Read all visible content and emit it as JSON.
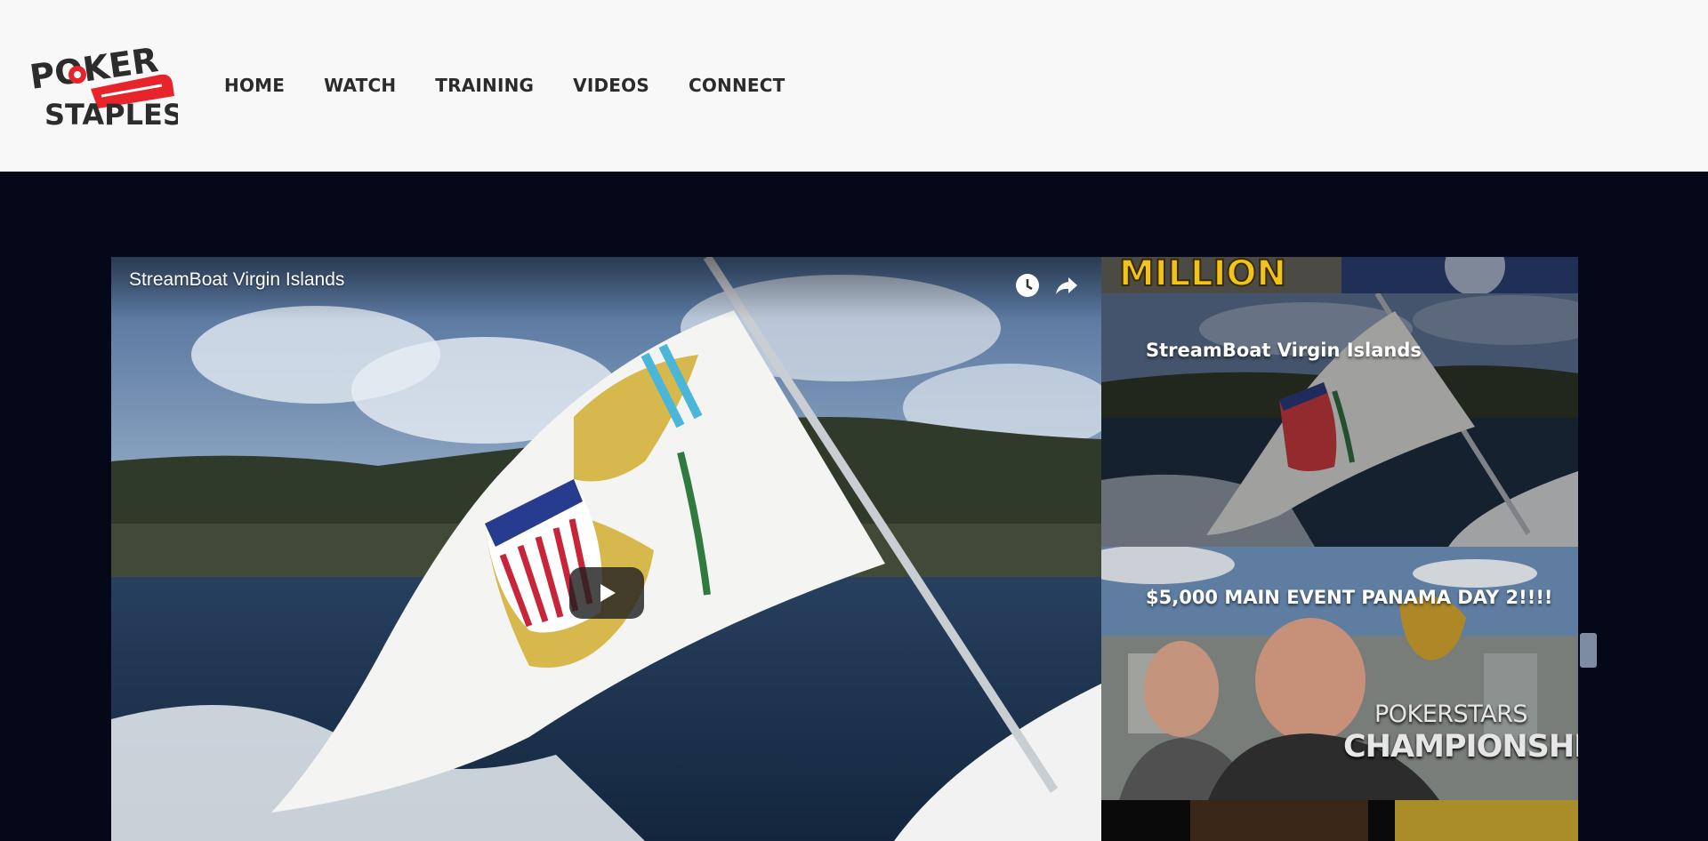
{
  "brand": {
    "logo_text_top": "POKER",
    "logo_text_bottom": "STAPLES",
    "accent": "#e8242b"
  },
  "nav": {
    "items": [
      {
        "label": "HOME"
      },
      {
        "label": "WATCH"
      },
      {
        "label": "TRAINING"
      },
      {
        "label": "VIDEOS"
      },
      {
        "label": "CONNECT"
      }
    ]
  },
  "player": {
    "title": "StreamBoat Virgin Islands",
    "icons": [
      "watch-later-icon",
      "share-icon",
      "play-icon"
    ]
  },
  "playlist": {
    "items": [
      {
        "title": "",
        "partial_text": "MILLION"
      },
      {
        "title": "StreamBoat Virgin Islands"
      },
      {
        "title": "$5,000 MAIN EVENT PANAMA DAY 2!!!!",
        "overlay_line1": "POKERSTARS",
        "overlay_line2": "CHAMPIONSHIP"
      },
      {
        "title": ""
      }
    ]
  },
  "colors": {
    "header_bg": "#f8f8f8",
    "page_bg": "#050818",
    "nav_text": "#2b2b2b"
  }
}
